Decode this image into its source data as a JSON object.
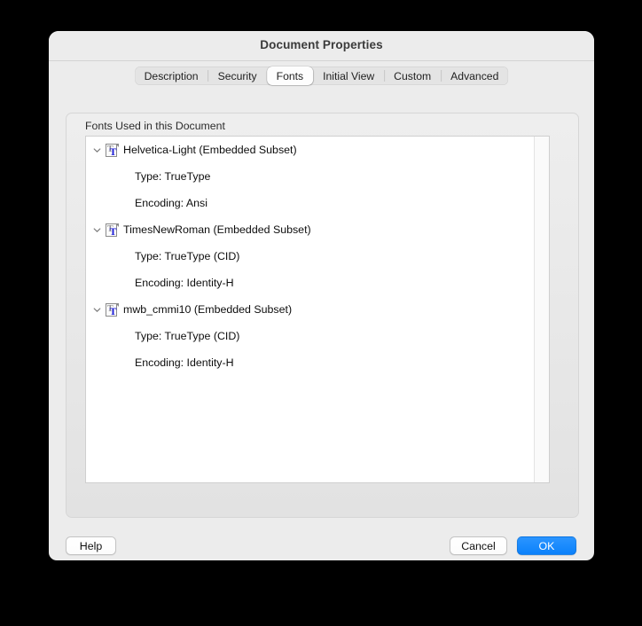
{
  "window": {
    "title": "Document Properties"
  },
  "tabs": [
    {
      "label": "Description",
      "selected": false
    },
    {
      "label": "Security",
      "selected": false
    },
    {
      "label": "Fonts",
      "selected": true
    },
    {
      "label": "Initial View",
      "selected": false
    },
    {
      "label": "Custom",
      "selected": false
    },
    {
      "label": "Advanced",
      "selected": false
    }
  ],
  "fonts_panel": {
    "group_label": "Fonts Used in this Document",
    "entries": [
      {
        "name": "Helvetica-Light (Embedded Subset)",
        "icon": "font-file-icon",
        "expanded": true,
        "details": [
          "Type: TrueType",
          "Encoding: Ansi"
        ]
      },
      {
        "name": "TimesNewRoman (Embedded Subset)",
        "icon": "font-file-icon",
        "expanded": true,
        "details": [
          "Type: TrueType (CID)",
          "Encoding: Identity-H"
        ]
      },
      {
        "name": "mwb_cmmi10 (Embedded Subset)",
        "icon": "font-file-icon",
        "expanded": true,
        "details": [
          "Type: TrueType (CID)",
          "Encoding: Identity-H"
        ]
      }
    ]
  },
  "buttons": {
    "help": "Help",
    "cancel": "Cancel",
    "ok": "OK"
  },
  "colors": {
    "accent": "#0b81fb",
    "window_background": "#ececec",
    "list_background": "#ffffff",
    "icon_letter": "#1a1ad6"
  }
}
